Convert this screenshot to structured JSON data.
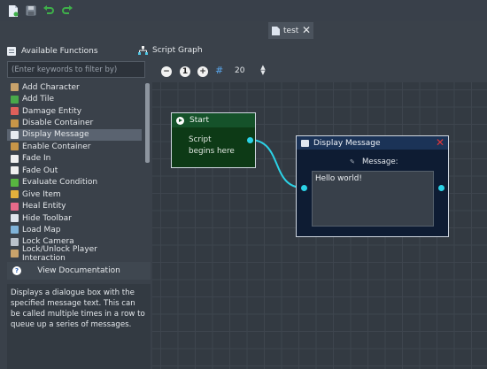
{
  "toolbar": {
    "buttons": [
      {
        "name": "new-file-icon",
        "color": "#e8eef6"
      },
      {
        "name": "save-icon",
        "color": "#7e8894"
      },
      {
        "name": "undo-icon",
        "color": "#3fb04a"
      },
      {
        "name": "redo-icon",
        "color": "#3fb04a"
      }
    ]
  },
  "tabs": [
    {
      "label": "test",
      "active": true,
      "close": "✕"
    }
  ],
  "left_panel": {
    "title": "Available Functions",
    "filter_placeholder": "(Enter keywords to filter by)",
    "functions": [
      {
        "label": "Add Character",
        "icon": "character-icon",
        "color": "#c9a36b"
      },
      {
        "label": "Add Tile",
        "icon": "tile-icon",
        "color": "#49a84a"
      },
      {
        "label": "Damage Entity",
        "icon": "damage-icon",
        "color": "#e0605a"
      },
      {
        "label": "Disable Container",
        "icon": "container-icon",
        "color": "#c89648"
      },
      {
        "label": "Display Message",
        "icon": "message-icon",
        "color": "#e6eaf0",
        "selected": true
      },
      {
        "label": "Enable Container",
        "icon": "container-icon",
        "color": "#c89648"
      },
      {
        "label": "Fade In",
        "icon": "fade-in-icon",
        "color": "#f0f0f0"
      },
      {
        "label": "Fade Out",
        "icon": "fade-out-icon",
        "color": "#f0f0f0"
      },
      {
        "label": "Evaluate Condition",
        "icon": "condition-icon",
        "color": "#58b640"
      },
      {
        "label": "Give Item",
        "icon": "item-icon",
        "color": "#e3b13c"
      },
      {
        "label": "Heal Entity",
        "icon": "heal-icon",
        "color": "#e86a8a"
      },
      {
        "label": "Hide Toolbar",
        "icon": "toolbar-icon",
        "color": "#dfe5ec"
      },
      {
        "label": "Load Map",
        "icon": "map-icon",
        "color": "#7fb2d8"
      },
      {
        "label": "Lock Camera",
        "icon": "camera-icon",
        "color": "#b9c1ca"
      },
      {
        "label": "Lock/Unlock Player Interaction",
        "icon": "lock-icon",
        "color": "#c9a36b"
      }
    ],
    "doc_button": "View Documentation",
    "description": "Displays a dialogue box with the specified message text. This can be called multiple times in a row to queue up a series of messages."
  },
  "graph": {
    "title": "Script Graph",
    "zoom_out": "−",
    "zoom_reset": "1",
    "zoom_in": "+",
    "zoom_value": "20",
    "nodes": {
      "start": {
        "title": "Start",
        "body": "Script begins here"
      },
      "display_message": {
        "title": "Display Message",
        "close": "✕",
        "field_label": "Message:",
        "field_value": "Hello world!"
      }
    },
    "wire_color": "#2bd2e6"
  }
}
